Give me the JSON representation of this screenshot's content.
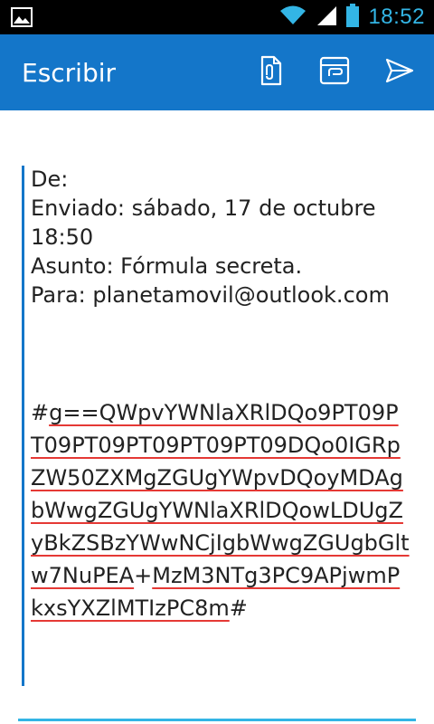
{
  "status_bar": {
    "time": "18:52",
    "icons": [
      "picture-notification-icon",
      "wifi-icon",
      "signal-icon",
      "battery-icon"
    ]
  },
  "app_bar": {
    "title": "Escribir",
    "actions": [
      "attach-file-icon",
      "attach-from-storage-icon",
      "send-icon"
    ]
  },
  "message": {
    "from_line": "De:",
    "sent_line": "Enviado: sábado, 17 de octubre 18:50",
    "subject_line": "Asunto: Fórmula secreta.",
    "to_line": "Para: planetamovil@outlook.com",
    "code_prefix": "#",
    "code_part1": "g==QWpvYWNlaXRlDQo9PT09PT09PT09PT09PT09PT09DQo0IGRpZW50ZXMgZGUgYWpvDQoyMDAgbWwgZGUgYWNlaXRlDQowLDUgZyBkZSBzYWwNCjIgbWwgZGUgbGltw7NuPEA",
    "code_plus": "+",
    "code_part2": "MzM3NTg3PC9APjwmPkxsYXZlMTIzPC8m",
    "code_suffix": "#"
  },
  "colors": {
    "accent": "#1476c9",
    "status_accent": "#33b5e5",
    "spellcheck": "#e53935"
  }
}
